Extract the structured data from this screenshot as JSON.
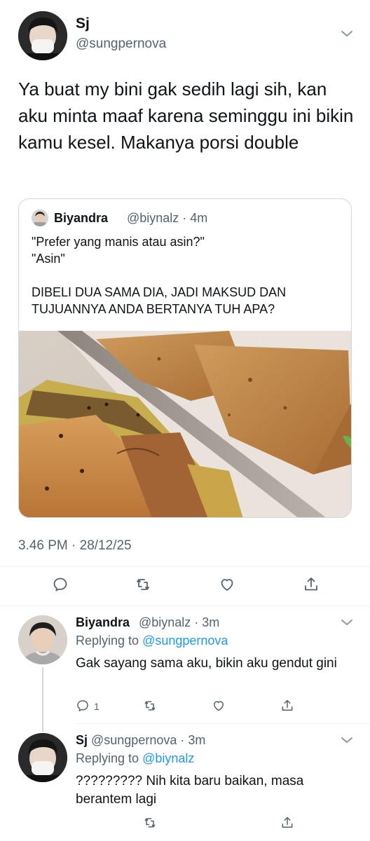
{
  "main_tweet": {
    "name": "Sj",
    "handle": "@sungpernova",
    "text": "Ya buat my bini gak sedih lagi sih, kan aku minta maaf karena seminggu ini bikin kamu kesel. Makanya porsi double",
    "timestamp": "3.46 PM · 28/12/25",
    "icons": [
      "reply-icon",
      "retweet-icon",
      "like-icon",
      "share-icon"
    ]
  },
  "quote": {
    "name": "Biyandra",
    "handle_time": "@biynalz · 4m",
    "text": "\"Prefer yang manis atau asin?\"\n\"Asin\"\n\nDIBELI DUA SAMA DIA, JADI MAKSUD DAN TUJUANNYA ANDA BERTANYA TUH APA?"
  },
  "replies": [
    {
      "name": "Biyandra",
      "handle_time": "@biynalz · 3m",
      "replying_prefix": "Replying to",
      "replying_to": "@sungpernova",
      "text": "Gak sayang sama aku, bikin aku gendut gini",
      "reply_count": "1"
    },
    {
      "name": "Sj",
      "handle_time": "@sungpernova · 3m",
      "replying_prefix": "Replying to",
      "replying_to": "@biynalz",
      "text": "????????? Nih kita baru baikan, masa berantem lagi"
    }
  ],
  "colors": {
    "accent": "#1d9bf0",
    "muted": "#536471",
    "text": "#0f1419",
    "border": "#cfd9de"
  }
}
